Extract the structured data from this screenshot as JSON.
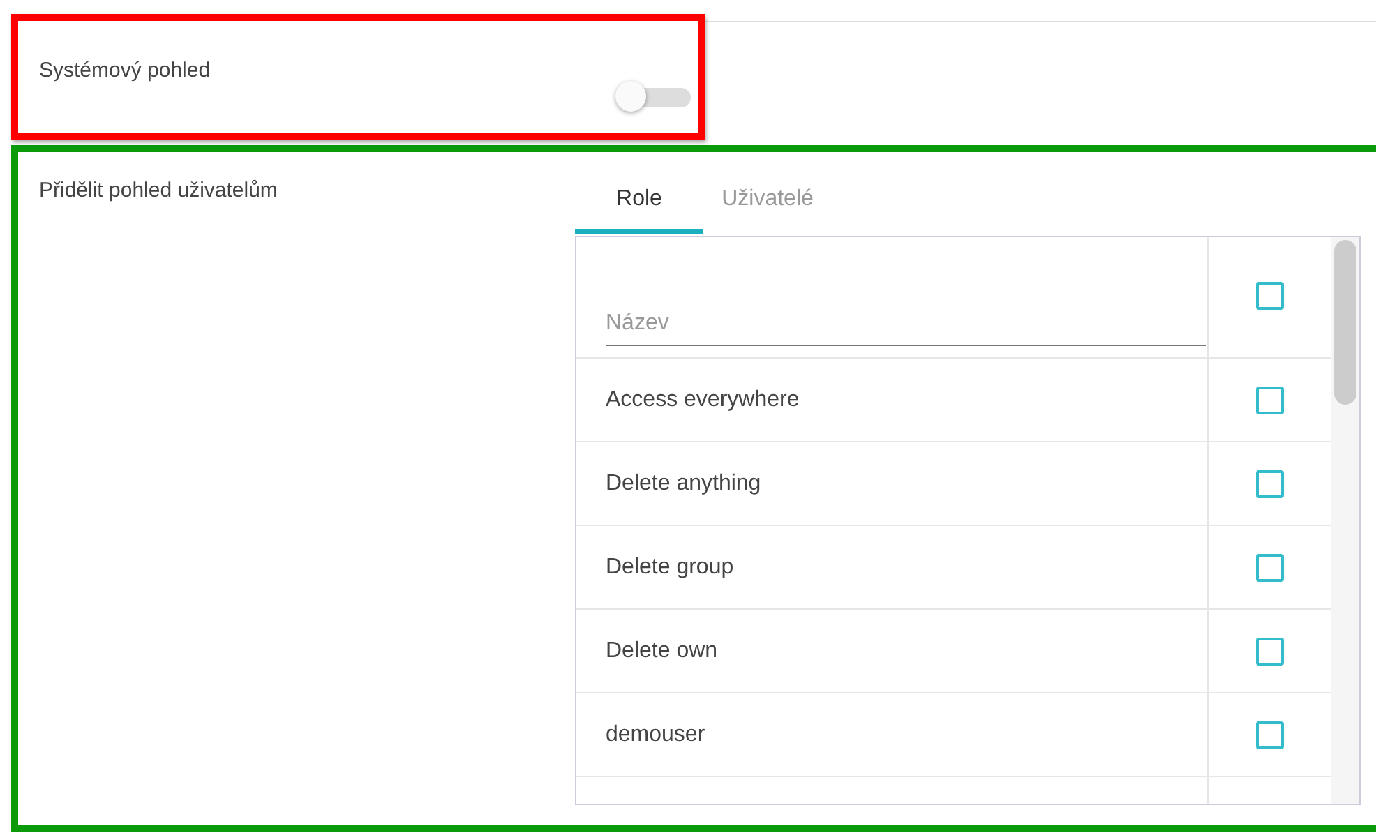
{
  "system_view": {
    "label": "Systémový pohled",
    "on": false
  },
  "assign": {
    "label": "Přidělit pohled uživatelům",
    "tabs": [
      {
        "label": "Role",
        "selected": true
      },
      {
        "label": "Uživatelé",
        "selected": false
      }
    ],
    "filter": {
      "placeholder": "Název",
      "checked": false
    },
    "rows": [
      {
        "name": "Access everywhere",
        "checked": false
      },
      {
        "name": "Delete anything",
        "checked": false
      },
      {
        "name": "Delete group",
        "checked": false
      },
      {
        "name": "Delete own",
        "checked": false
      },
      {
        "name": "demouser",
        "checked": false
      }
    ]
  }
}
